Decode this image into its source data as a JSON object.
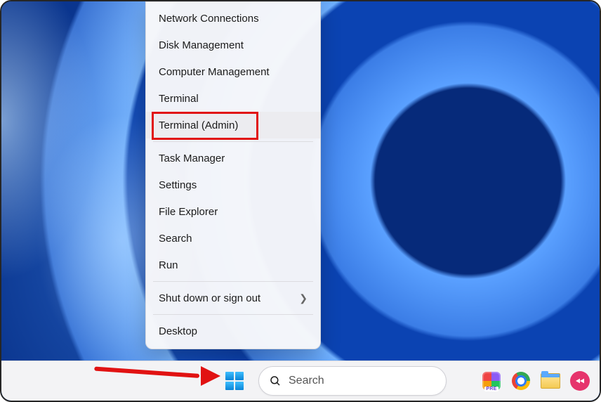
{
  "colors": {
    "highlight": "#e11212",
    "taskbar_bg": "#f3f3f5",
    "menu_bg": "#f8f8fa"
  },
  "menu": {
    "items": [
      {
        "label": "Network Connections",
        "submenu": false
      },
      {
        "label": "Disk Management",
        "submenu": false
      },
      {
        "label": "Computer Management",
        "submenu": false
      },
      {
        "label": "Terminal",
        "submenu": false
      },
      {
        "label": "Terminal (Admin)",
        "submenu": false,
        "highlighted": true
      }
    ],
    "items2": [
      {
        "label": "Task Manager",
        "submenu": false
      },
      {
        "label": "Settings",
        "submenu": false
      },
      {
        "label": "File Explorer",
        "submenu": false
      },
      {
        "label": "Search",
        "submenu": false
      },
      {
        "label": "Run",
        "submenu": false
      }
    ],
    "items3": [
      {
        "label": "Shut down or sign out",
        "submenu": true
      }
    ],
    "items4": [
      {
        "label": "Desktop",
        "submenu": false
      }
    ]
  },
  "taskbar": {
    "search_placeholder": "Search",
    "ms_badge": "PRE",
    "icons": [
      "ms365-icon",
      "chrome-icon",
      "file-explorer-icon",
      "app-launcher-icon"
    ]
  }
}
